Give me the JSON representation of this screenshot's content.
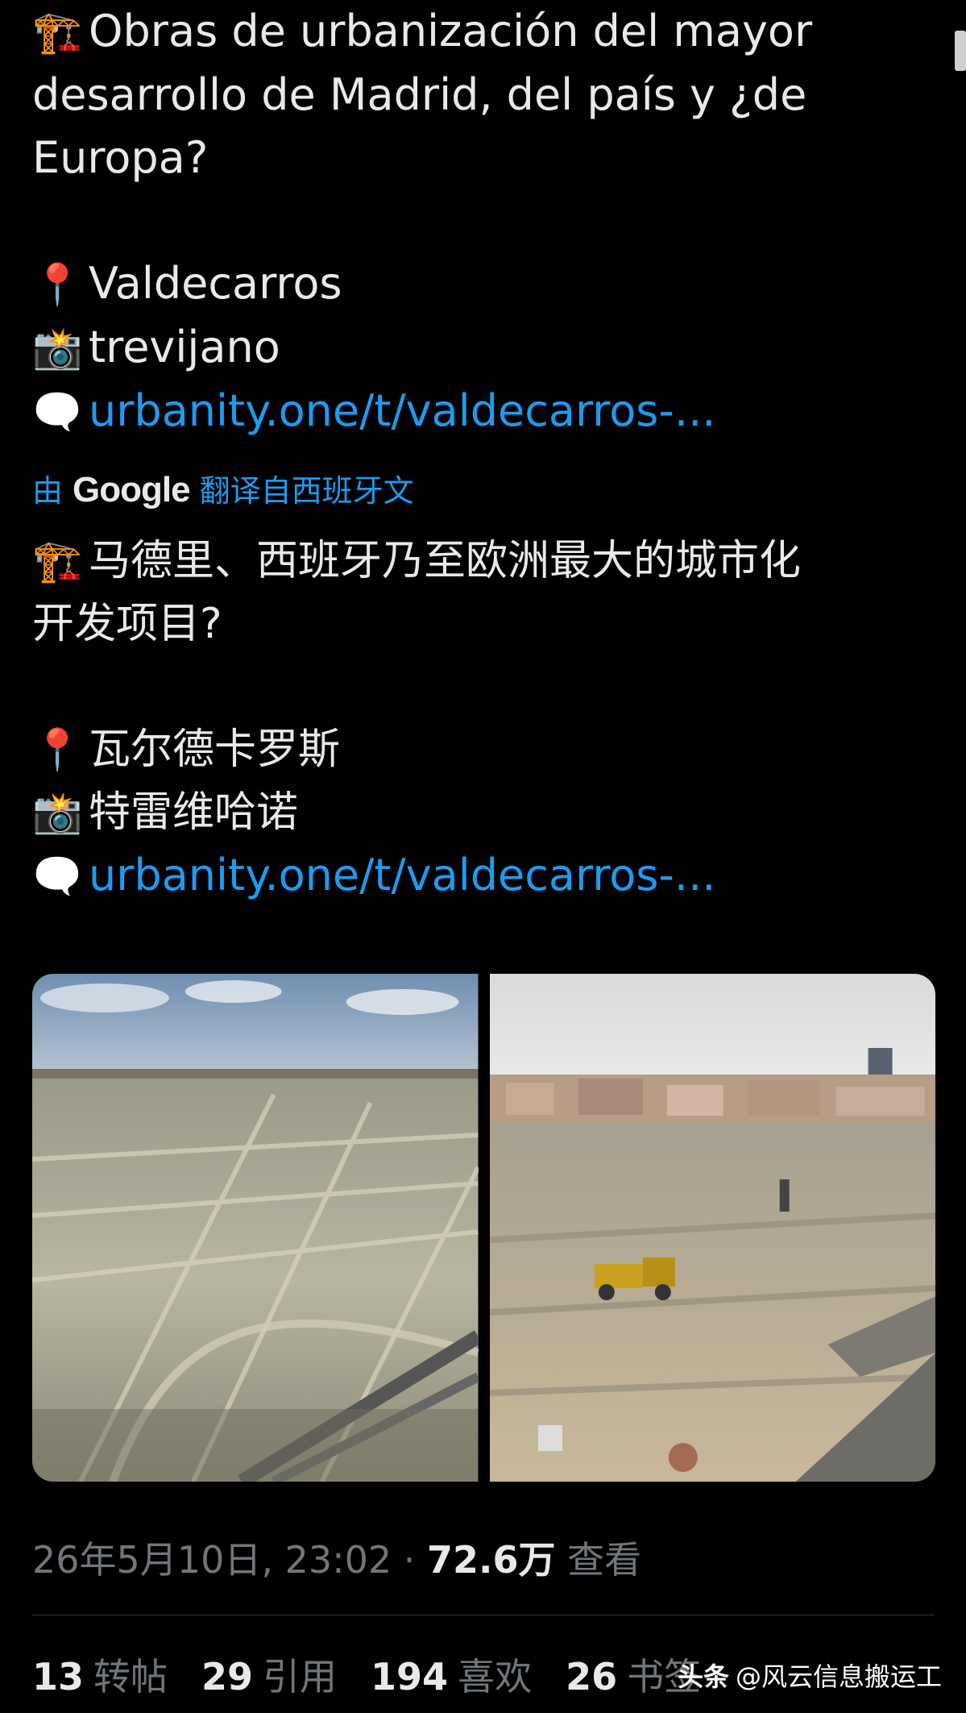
{
  "original": {
    "title_line1": "Obras de urbanización del mayor",
    "title_line2": "desarrollo de Madrid, del país y ¿de",
    "title_line3": "Europa?",
    "location": "Valdecarros",
    "photographer": "trevijano",
    "link": "urbanity.one/t/valdecarros-..."
  },
  "translation_bar": {
    "prefix": "由",
    "brand": "Google",
    "suffix": "翻译自西班牙文"
  },
  "translated": {
    "title_line1": "马德里、西班牙乃至欧洲最大的城市化",
    "title_line2": "开发项目?",
    "location": "瓦尔德卡罗斯",
    "photographer": "特雷维哈诺",
    "link": "urbanity.one/t/valdecarros-..."
  },
  "icons": {
    "crane": "🏗️",
    "pin": "📍",
    "camera": "📸",
    "speech": "🗨️"
  },
  "meta": {
    "timestamp": "26年5月10日, 23:02",
    "separator": "·",
    "views_count": "72.6万",
    "views_label": "查看"
  },
  "stats": {
    "retweets_count": "13",
    "retweets_label": "转帖",
    "quotes_count": "29",
    "quotes_label": "引用",
    "likes_count": "194",
    "likes_label": "喜欢",
    "bookmarks_count": "26",
    "bookmarks_label": "书签"
  },
  "watermark": {
    "brand": "头条",
    "handle": "@风云信息搬运工"
  },
  "colors": {
    "background": "#000000",
    "text": "#e7e9ea",
    "link": "#1d9bf0",
    "muted": "#71767b"
  }
}
